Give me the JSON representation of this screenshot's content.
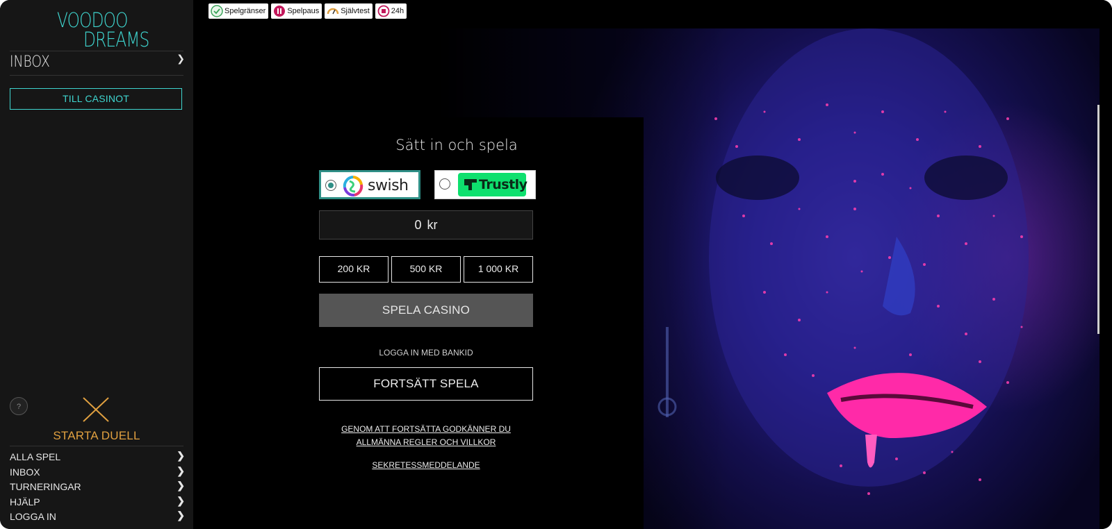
{
  "logo": {
    "line1": "VOODOO",
    "line2": "DREAMS",
    "color": "#3fd6d0"
  },
  "sidebar": {
    "inbox_label": "INBOX",
    "chevron": "❯",
    "till_casinot_label": "TILL CASINOT",
    "help_label": "?",
    "duel_label": "STARTA DUELL",
    "menu": [
      {
        "label": "ALLA SPEL"
      },
      {
        "label": "INBOX"
      },
      {
        "label": "TURNERINGAR"
      },
      {
        "label": "HJÄLP"
      },
      {
        "label": "LOGGA IN"
      }
    ]
  },
  "safety_bar": [
    {
      "label": "Spelgränser",
      "icon": "limits-icon",
      "color": "#3aa35a"
    },
    {
      "label": "Spelpaus",
      "icon": "pause-icon",
      "color": "#c2185b"
    },
    {
      "label": "Självtest",
      "icon": "gauge-icon",
      "color": "#e0a040"
    },
    {
      "label": "24h",
      "icon": "stop-icon",
      "color": "#c2185b"
    }
  ],
  "deposit": {
    "title": "Sätt in och spela",
    "payment_methods": [
      {
        "name": "swish",
        "selected": true
      },
      {
        "name": "Trustly",
        "selected": false
      }
    ],
    "amount_value": "0",
    "currency": "kr",
    "quick_amounts": [
      "200 KR",
      "500 KR",
      "1 000 KR"
    ],
    "play_button": "SPELA CASINO",
    "bankid_label": "LOGGA IN MED BANKID",
    "continue_button": "FORTSÄTT SPELA",
    "terms_line1": "GENOM ATT FORTSÄTTA GODKÄNNER DU",
    "terms_line2": "ALLMÄNNA REGLER OCH VILLKOR",
    "privacy_link": "SEKRETESSMEDDELANDE"
  },
  "colors": {
    "accent": "#3fd6d0",
    "duel": "#e0a040",
    "swish_border": "#2f8f86",
    "trustly": "#0ee06e"
  }
}
